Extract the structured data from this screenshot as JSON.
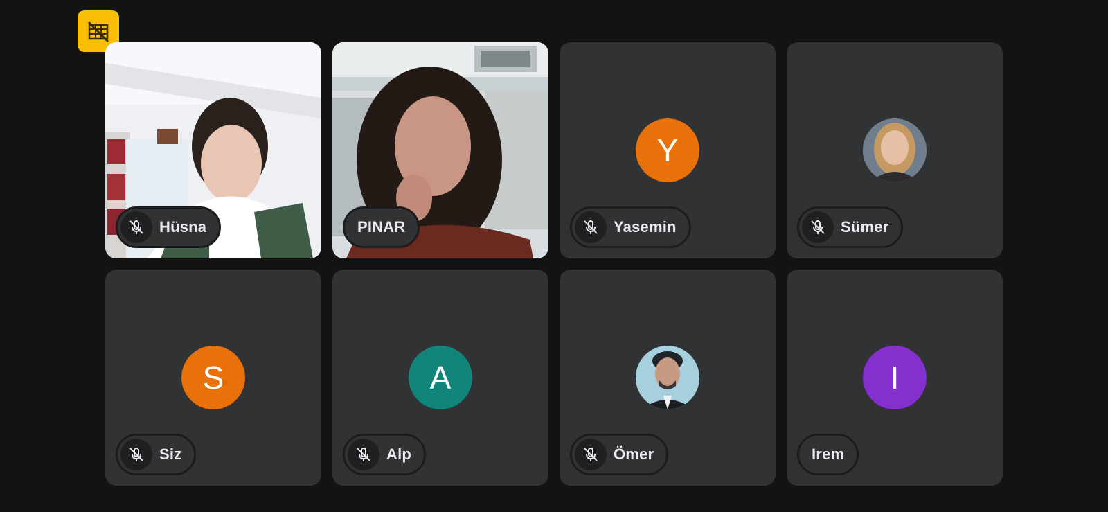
{
  "badge": {
    "icon": "no-video-grid-icon",
    "color": "#f9bf06"
  },
  "participants": [
    {
      "name": "Hüsna",
      "muted": true,
      "type": "video"
    },
    {
      "name": "PINAR",
      "muted": false,
      "type": "video"
    },
    {
      "name": "Yasemin",
      "muted": true,
      "type": "initial",
      "initial": "Y",
      "color": "#e8710a"
    },
    {
      "name": "Sümer",
      "muted": true,
      "type": "photo"
    },
    {
      "name": "Siz",
      "muted": true,
      "type": "initial",
      "initial": "S",
      "color": "#e8710a"
    },
    {
      "name": "Alp",
      "muted": true,
      "type": "initial",
      "initial": "A",
      "color": "#12857a"
    },
    {
      "name": "Ömer",
      "muted": true,
      "type": "photo"
    },
    {
      "name": "Irem",
      "muted": false,
      "type": "initial",
      "initial": "I",
      "color": "#8430ce"
    }
  ]
}
